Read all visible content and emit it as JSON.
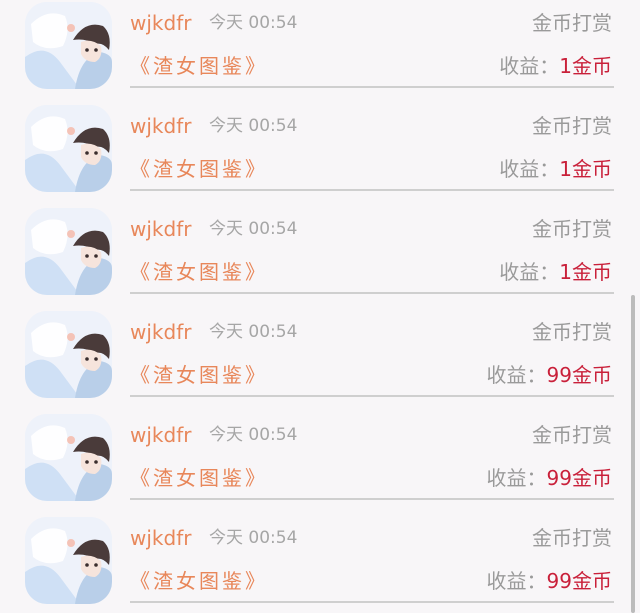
{
  "colors": {
    "username": "#e8875a",
    "work_title": "#e8875a",
    "meta_gray": "#a6a6a6",
    "amount_red": "#c9203a",
    "divider": "#cfcfcf",
    "background": "#f8f6f8"
  },
  "rows": [
    {
      "user": "wjkdfr",
      "time": "今天 00:54",
      "type": "金币打赏",
      "work": "《渣女图鉴》",
      "earn_label": "收益：",
      "earn_amount": "1金币",
      "avatar": "anime-avatar-icon"
    },
    {
      "user": "wjkdfr",
      "time": "今天 00:54",
      "type": "金币打赏",
      "work": "《渣女图鉴》",
      "earn_label": "收益：",
      "earn_amount": "1金币",
      "avatar": "anime-avatar-icon"
    },
    {
      "user": "wjkdfr",
      "time": "今天 00:54",
      "type": "金币打赏",
      "work": "《渣女图鉴》",
      "earn_label": "收益：",
      "earn_amount": "1金币",
      "avatar": "anime-avatar-icon"
    },
    {
      "user": "wjkdfr",
      "time": "今天 00:54",
      "type": "金币打赏",
      "work": "《渣女图鉴》",
      "earn_label": "收益：",
      "earn_amount": "99金币",
      "avatar": "anime-avatar-icon"
    },
    {
      "user": "wjkdfr",
      "time": "今天 00:54",
      "type": "金币打赏",
      "work": "《渣女图鉴》",
      "earn_label": "收益：",
      "earn_amount": "99金币",
      "avatar": "anime-avatar-icon"
    },
    {
      "user": "wjkdfr",
      "time": "今天 00:54",
      "type": "金币打赏",
      "work": "《渣女图鉴》",
      "earn_label": "收益：",
      "earn_amount": "99金币",
      "avatar": "anime-avatar-icon"
    }
  ]
}
